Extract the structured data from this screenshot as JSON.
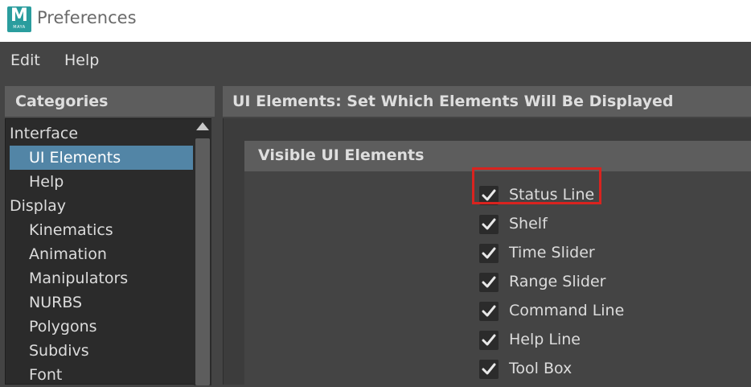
{
  "window": {
    "title": "Preferences",
    "app_icon_letter": "M",
    "app_icon_text": "MAYA"
  },
  "menubar": {
    "items": [
      "Edit",
      "Help"
    ]
  },
  "categories": {
    "header": "Categories",
    "items": [
      {
        "label": "Interface",
        "level": 0,
        "selected": false
      },
      {
        "label": "UI Elements",
        "level": 1,
        "selected": true
      },
      {
        "label": "Help",
        "level": 1,
        "selected": false
      },
      {
        "label": "Display",
        "level": 0,
        "selected": false
      },
      {
        "label": "Kinematics",
        "level": 1,
        "selected": false
      },
      {
        "label": "Animation",
        "level": 1,
        "selected": false
      },
      {
        "label": "Manipulators",
        "level": 1,
        "selected": false
      },
      {
        "label": "NURBS",
        "level": 1,
        "selected": false
      },
      {
        "label": "Polygons",
        "level": 1,
        "selected": false
      },
      {
        "label": "Subdivs",
        "level": 1,
        "selected": false
      },
      {
        "label": "Font",
        "level": 1,
        "selected": false
      }
    ]
  },
  "main": {
    "header": "UI Elements: Set Which Elements Will Be Displayed",
    "section": {
      "title": "Visible UI Elements",
      "options": [
        {
          "label": "Status Line",
          "checked": true,
          "highlighted": true
        },
        {
          "label": "Shelf",
          "checked": true,
          "highlighted": false
        },
        {
          "label": "Time Slider",
          "checked": true,
          "highlighted": false
        },
        {
          "label": "Range Slider",
          "checked": true,
          "highlighted": false
        },
        {
          "label": "Command Line",
          "checked": true,
          "highlighted": false
        },
        {
          "label": "Help Line",
          "checked": true,
          "highlighted": false
        },
        {
          "label": "Tool Box",
          "checked": true,
          "highlighted": false
        }
      ]
    }
  },
  "colors": {
    "selection": "#5285a6",
    "highlight": "#d9231f",
    "maya_icon": "#2a9d9e"
  }
}
